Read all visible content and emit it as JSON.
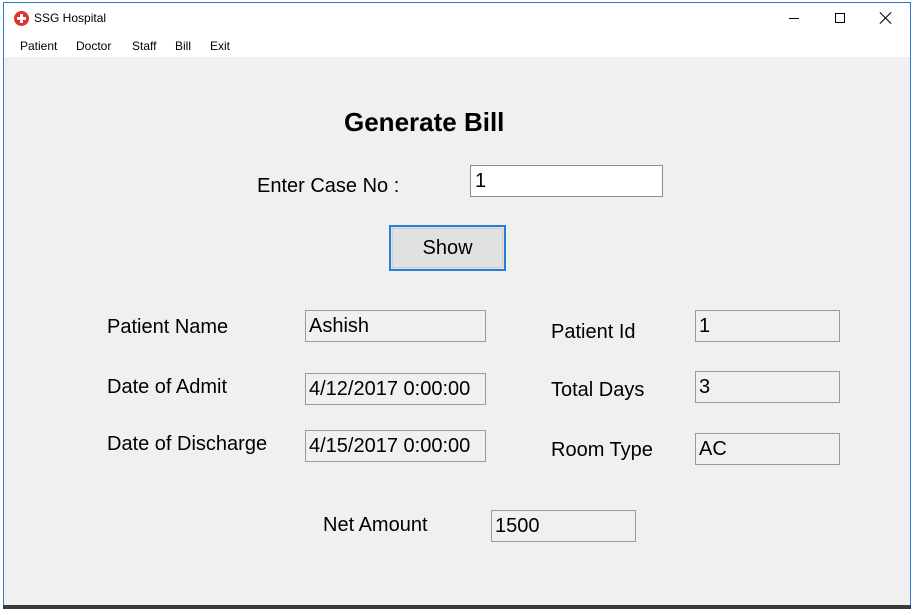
{
  "window": {
    "title": "SSG Hospital"
  },
  "menu": [
    {
      "label": "Patient"
    },
    {
      "label": "Doctor"
    },
    {
      "label": "Staff"
    },
    {
      "label": "Bill"
    },
    {
      "label": "Exit"
    }
  ],
  "form": {
    "heading": "Generate Bill",
    "case_label": "Enter Case No :",
    "case_value": "1",
    "show_label": "Show",
    "patient_name_label": "Patient Name",
    "patient_name": "Ashish",
    "admit_label": "Date of Admit",
    "admit_value": "4/12/2017 0:00:00",
    "discharge_label": "Date of Discharge",
    "discharge_value": "4/15/2017 0:00:00",
    "patient_id_label": "Patient Id",
    "patient_id": "1",
    "total_days_label": "Total Days",
    "total_days": "3",
    "room_type_label": "Room Type",
    "room_type": "AC",
    "net_amount_label": "Net Amount",
    "net_amount": "1500"
  }
}
